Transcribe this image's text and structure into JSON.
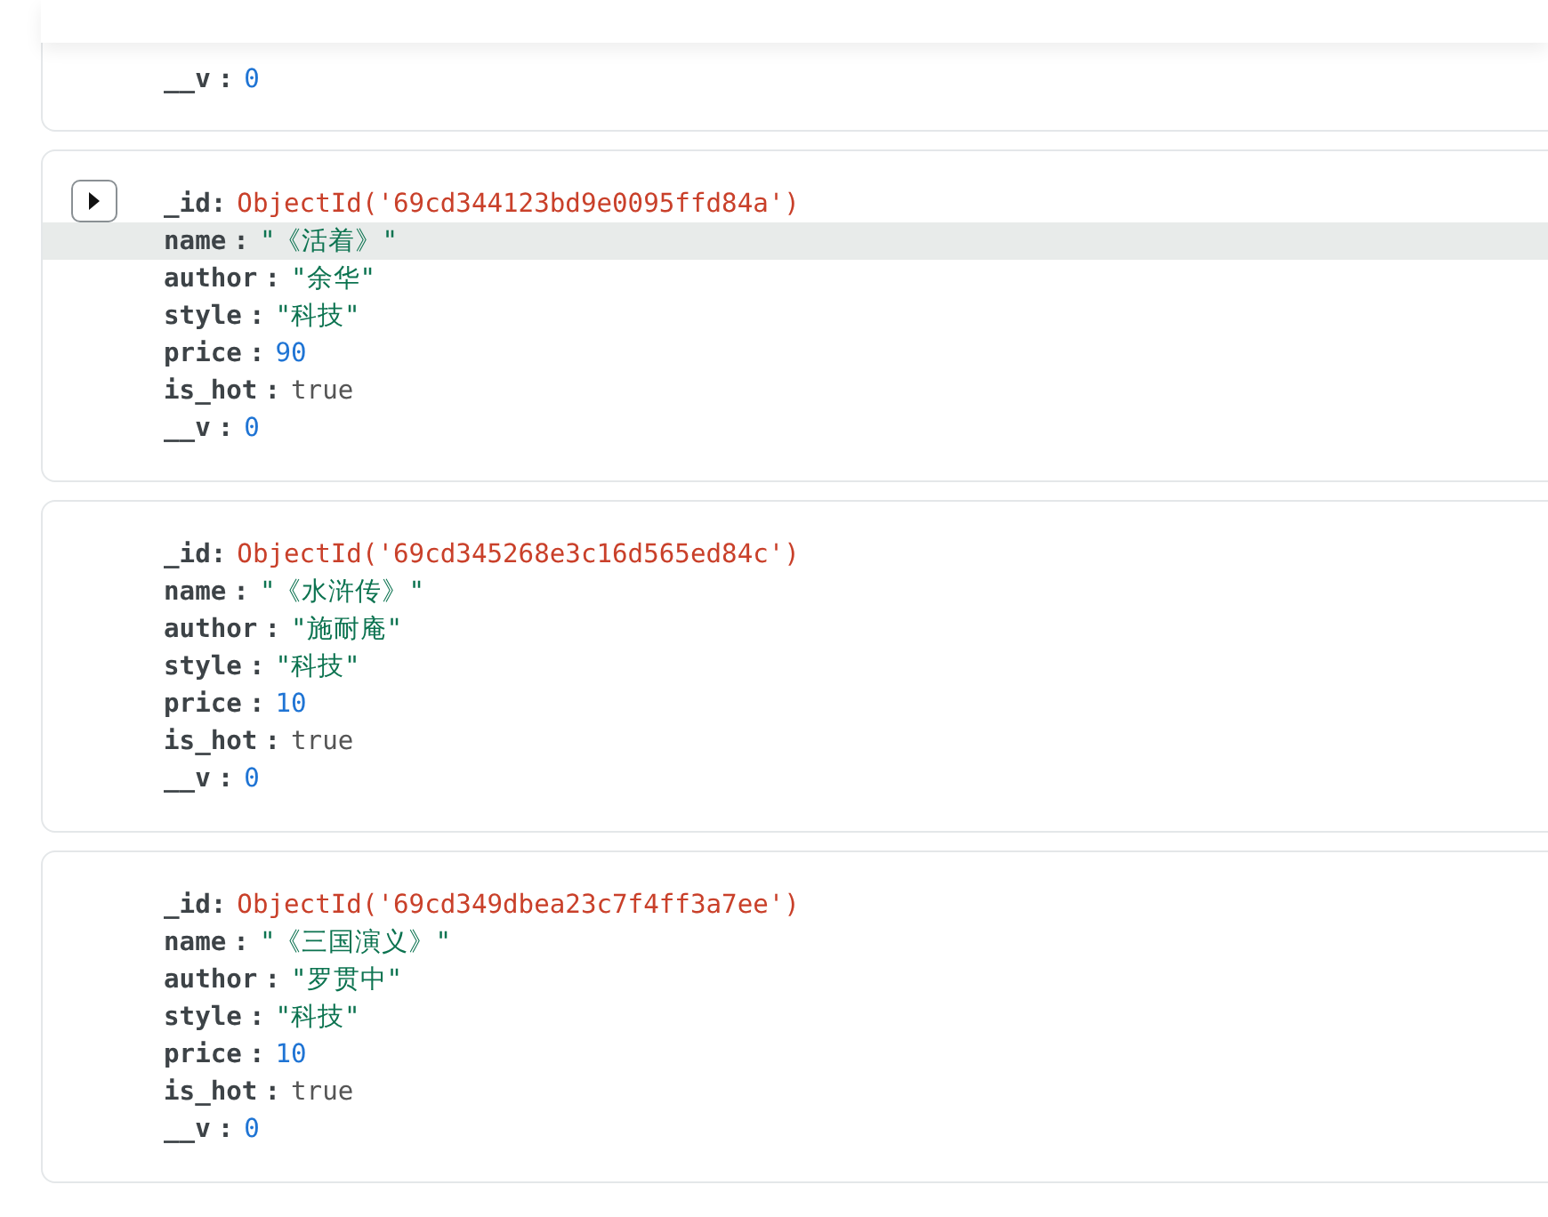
{
  "documents": [
    {
      "show_expand": false,
      "fields": [
        {
          "key": "__v",
          "colon": ":",
          "value": "0",
          "kind": "number",
          "highlighted": false
        }
      ]
    },
    {
      "show_expand": true,
      "fields": [
        {
          "key": "_id",
          "colon": ":",
          "value": "ObjectId('69cd344123bd9e0095ffd84a')",
          "kind": "objectid",
          "highlighted": false
        },
        {
          "key": "name",
          "colon": ":",
          "value": "\"《活着》\"",
          "kind": "string",
          "highlighted": true
        },
        {
          "key": "author",
          "colon": ":",
          "value": "\"余华\"",
          "kind": "string",
          "highlighted": false
        },
        {
          "key": "style",
          "colon": ":",
          "value": "\"科技\"",
          "kind": "string",
          "highlighted": false
        },
        {
          "key": "price",
          "colon": ":",
          "value": "90",
          "kind": "number",
          "highlighted": false
        },
        {
          "key": "is_hot",
          "colon": ":",
          "value": "true",
          "kind": "boolean",
          "highlighted": false
        },
        {
          "key": "__v",
          "colon": ":",
          "value": "0",
          "kind": "number",
          "highlighted": false
        }
      ]
    },
    {
      "show_expand": false,
      "fields": [
        {
          "key": "_id",
          "colon": ":",
          "value": "ObjectId('69cd345268e3c16d565ed84c')",
          "kind": "objectid",
          "highlighted": false
        },
        {
          "key": "name",
          "colon": ":",
          "value": "\"《水浒传》\"",
          "kind": "string",
          "highlighted": false
        },
        {
          "key": "author",
          "colon": ":",
          "value": "\"施耐庵\"",
          "kind": "string",
          "highlighted": false
        },
        {
          "key": "style",
          "colon": ":",
          "value": "\"科技\"",
          "kind": "string",
          "highlighted": false
        },
        {
          "key": "price",
          "colon": ":",
          "value": "10",
          "kind": "number",
          "highlighted": false
        },
        {
          "key": "is_hot",
          "colon": ":",
          "value": "true",
          "kind": "boolean",
          "highlighted": false
        },
        {
          "key": "__v",
          "colon": ":",
          "value": "0",
          "kind": "number",
          "highlighted": false
        }
      ]
    },
    {
      "show_expand": false,
      "fields": [
        {
          "key": "_id",
          "colon": ":",
          "value": "ObjectId('69cd349dbea23c7f4ff3a7ee')",
          "kind": "objectid",
          "highlighted": false
        },
        {
          "key": "name",
          "colon": ":",
          "value": "\"《三国演义》\"",
          "kind": "string",
          "highlighted": false
        },
        {
          "key": "author",
          "colon": ":",
          "value": "\"罗贯中\"",
          "kind": "string",
          "highlighted": false
        },
        {
          "key": "style",
          "colon": ":",
          "value": "\"科技\"",
          "kind": "string",
          "highlighted": false
        },
        {
          "key": "price",
          "colon": ":",
          "value": "10",
          "kind": "number",
          "highlighted": false
        },
        {
          "key": "is_hot",
          "colon": ":",
          "value": "true",
          "kind": "boolean",
          "highlighted": false
        },
        {
          "key": "__v",
          "colon": ":",
          "value": "0",
          "kind": "number",
          "highlighted": false
        }
      ]
    }
  ]
}
